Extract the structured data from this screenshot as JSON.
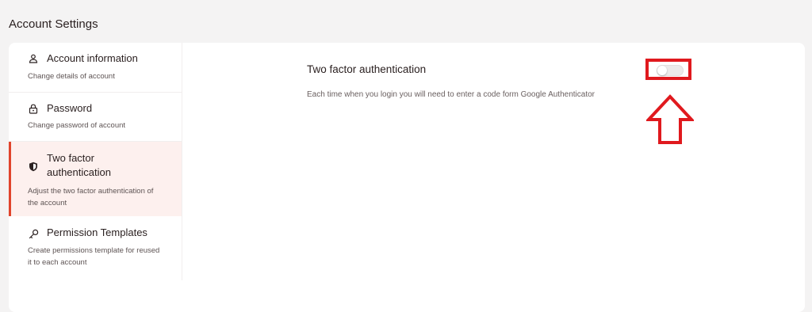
{
  "page": {
    "title": "Account Settings"
  },
  "sidebar": {
    "items": [
      {
        "label": "Account information",
        "description": "Change details of account",
        "icon": "user-icon",
        "active": false
      },
      {
        "label": "Password",
        "description": "Change password of account",
        "icon": "lock-icon",
        "active": false
      },
      {
        "label": "Two factor authentication",
        "label_line1": "Two factor",
        "label_line2": "authentication",
        "description": "Adjust the two factor authentication of the account",
        "desc_line1": "Adjust the two factor authentication of",
        "desc_line2": "the account",
        "icon": "shield-icon",
        "active": true
      },
      {
        "label": "Permission Templates",
        "description": "Create permissions template for reused it to each account",
        "desc_line1": "Create permissions template for reused",
        "desc_line2": "it to each account",
        "icon": "key-icon",
        "active": false
      }
    ]
  },
  "main": {
    "title": "Two factor authentication",
    "description": "Each time when you login you will need to enter a code form Google Authenticator",
    "toggle": {
      "enabled": false
    }
  },
  "colors": {
    "accent": "#e0442c",
    "active_bg": "#fdf0ee",
    "annotation": "#e0191e"
  }
}
